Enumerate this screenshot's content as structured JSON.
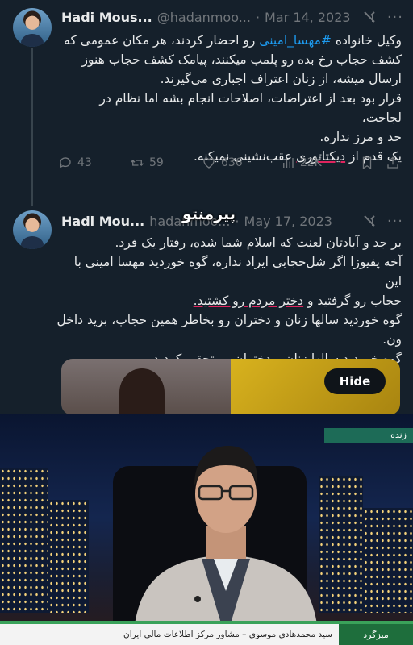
{
  "tweet1": {
    "name": "Hadi Mous...",
    "handle": "@hadanmoo...",
    "dot": "·",
    "date": "Mar 14, 2023",
    "line1_pre": "وکیل خانواده ",
    "hashtag": "#مهسا_امینی",
    "line1_post": " رو احضار کردند، هر مکان عمومی که",
    "line2": "کشف حجاب رخ بده رو پلمب میکنند، پیامک کشف حجاب هنوز",
    "line3": "ارسال میشه، از زنان اعتراف اجباری می‌گیرند.",
    "line4": "قرار بود بعد از اعتراضات، اصلاحات انجام بشه اما نظام در لجاجت،",
    "line5": "حد و مرز نداره.",
    "line6_pre": "یک قدم از ",
    "line6_underlined": "دیکتاتوری",
    "line6_post": " عقب‌نشینی نمیکنه.",
    "replies": "43",
    "retweets": "59",
    "likes": "636",
    "views": "22K"
  },
  "tweet2": {
    "name": "Hadi Mou...",
    "watermark": "پیرمنتو",
    "handle": "hadanmoo...",
    "dot": "·",
    "date": "May 17, 2023",
    "line1": "بر جد و آبادتان لعنت که اسلام شما شده، رفتار یک فرد.",
    "line2": "آخه پفیوزا اگر شل‌حجابی ایراد نداره، گوه خوردید مهسا امینی با این",
    "line3_pre": "حجاب رو گرفتید و ",
    "line3_underlined": "دختر مردم رو کشتید.",
    "line4": "گوه خوردید سالها زنان و دختران رو بخاطر همین حجاب، برید داخل",
    "line5": "ون.",
    "line6": "گوه خوردید سالها زنان و دختران رو تحقیر کردید.",
    "hide_label": "Hide"
  },
  "tv": {
    "live_tag": "زنده",
    "lower_label": "میزگرد",
    "caption": "سید محمدهادی موسوی – مشاور مرکز اطلاعات مالی ایران"
  }
}
